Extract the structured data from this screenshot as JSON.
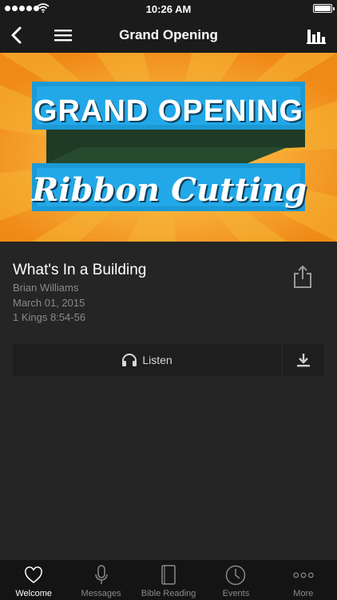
{
  "status_bar": {
    "time": "10:26 AM"
  },
  "nav": {
    "title": "Grand Opening"
  },
  "banner": {
    "line1": "GRAND OPENING",
    "line2": "Ribbon Cutting"
  },
  "message": {
    "title": "What's In a Building",
    "speaker": "Brian Williams",
    "date": "March 01, 2015",
    "scripture": "1 Kings 8:54-56"
  },
  "actions": {
    "listen_label": "Listen"
  },
  "tabs": [
    {
      "label": "Welcome",
      "icon": "heart-icon",
      "active": true
    },
    {
      "label": "Messages",
      "icon": "microphone-icon",
      "active": false
    },
    {
      "label": "Bible Reading",
      "icon": "book-icon",
      "active": false
    },
    {
      "label": "Events",
      "icon": "clock-icon",
      "active": false
    },
    {
      "label": "More",
      "icon": "more-icon",
      "active": false
    }
  ],
  "colors": {
    "background": "#252525",
    "bar": "#1b1b1b",
    "tab_bar": "#141414",
    "banner_orange": "#f5a21f",
    "banner_blue": "#1b9ad6",
    "muted_text": "#8a8a8a"
  }
}
